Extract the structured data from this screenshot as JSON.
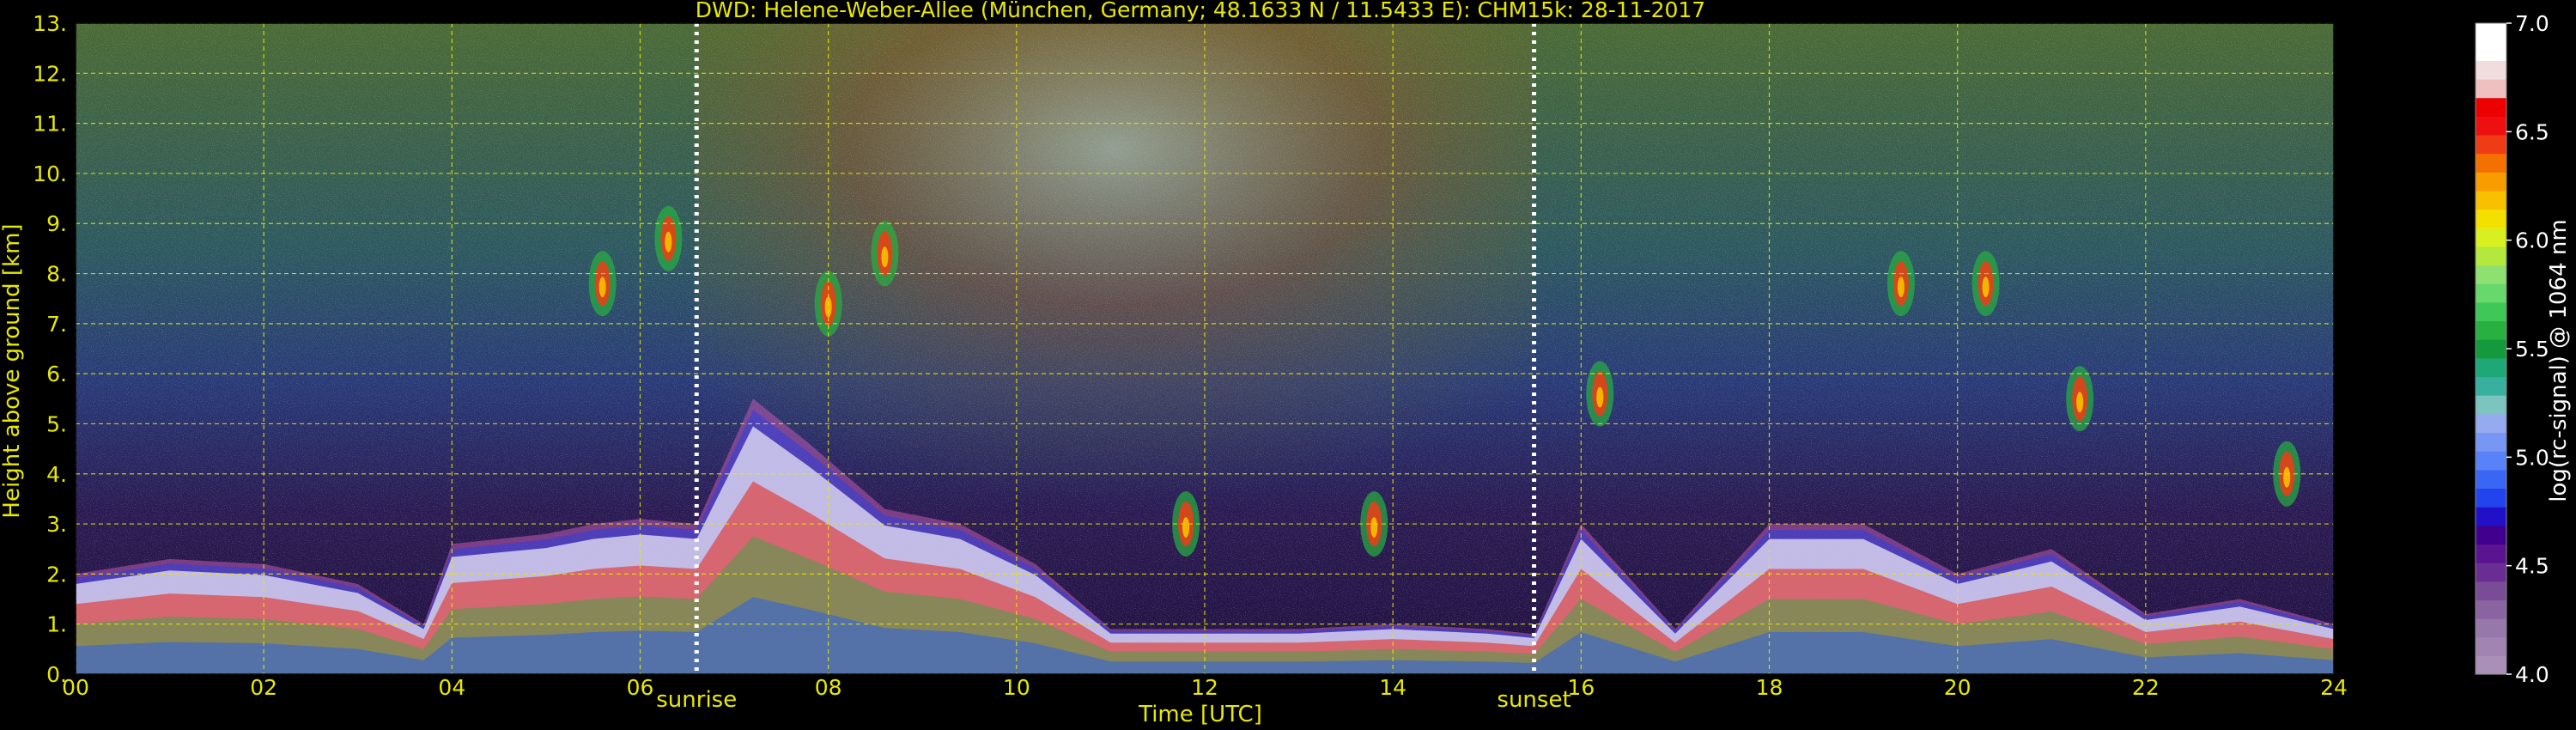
{
  "chart_data": {
    "type": "heatmap",
    "title": "DWD: Helene-Weber-Allee (München, Germany; 48.1633 N / 11.5433 E):    CHM15k: 28-11-2017",
    "xlabel": "Time [UTC]",
    "ylabel": "Height above ground [km]",
    "xlim": [
      0,
      24
    ],
    "ylim": [
      0,
      13
    ],
    "x_ticks": [
      "00",
      "02",
      "04",
      "06",
      "08",
      "10",
      "12",
      "14",
      "16",
      "18",
      "20",
      "22",
      "24"
    ],
    "y_ticks": [
      "0.",
      "1.",
      "2.",
      "3.",
      "4.",
      "5.",
      "6.",
      "7.",
      "8.",
      "9.",
      "10.",
      "11.",
      "12.",
      "13."
    ],
    "grid": true,
    "annotations": [
      {
        "text": "sunrise",
        "x": 6.6
      },
      {
        "text": "sunset",
        "x": 15.5
      }
    ],
    "colorbar": {
      "label": "log(rc-signal) @ 1064 nm",
      "range": [
        4.0,
        7.0
      ],
      "ticks": [
        "4.0",
        "4.5",
        "5.0",
        "5.5",
        "6.0",
        "6.5",
        "7.0"
      ],
      "colors": [
        "#a890b8",
        "#a284b2",
        "#9778aa",
        "#8a64a0",
        "#7a4c98",
        "#6a2e92",
        "#5a1490",
        "#42008e",
        "#2010c8",
        "#2244ee",
        "#3a66f4",
        "#5a82f8",
        "#7896f4",
        "#96aaf0",
        "#7cc4c0",
        "#38b0a0",
        "#1ea878",
        "#149a3c",
        "#28b040",
        "#3ec858",
        "#66d86c",
        "#8ee070",
        "#b4e83c",
        "#d8f020",
        "#f4e000",
        "#f8c000",
        "#f89c00",
        "#f47000",
        "#f03c14",
        "#ee1010",
        "#ec0000",
        "#f0c0c0",
        "#f0dede",
        "#ffffff",
        "#ffffff"
      ]
    },
    "series": [
      {
        "label": "boundary layer / aerosol top",
        "x": [
          0,
          1,
          2,
          3,
          3.7,
          4,
          5,
          5.5,
          6,
          6.6,
          7.2,
          7.8,
          8.6,
          9.4,
          10.2,
          11,
          12,
          13,
          14,
          15,
          15.5,
          16,
          17,
          18,
          19,
          20,
          21,
          22,
          23,
          24
        ],
        "y": [
          2.0,
          2.3,
          2.2,
          1.8,
          1.0,
          2.6,
          2.8,
          3.0,
          3.1,
          3.0,
          5.5,
          4.6,
          3.3,
          3.0,
          2.2,
          0.9,
          0.9,
          0.9,
          1.0,
          0.9,
          0.8,
          3.0,
          0.9,
          3.0,
          3.0,
          2.0,
          2.5,
          1.2,
          1.5,
          1.0
        ]
      },
      {
        "label": "cloud layers",
        "x": [
          5.6,
          6.3,
          8.0,
          8.6,
          11.8,
          13.8,
          16.2,
          19.4,
          20.3,
          21.3,
          23.5
        ],
        "y": [
          7.8,
          8.7,
          7.4,
          8.4,
          3.0,
          3.0,
          5.6,
          7.8,
          7.8,
          5.5,
          4.0
        ]
      }
    ]
  }
}
